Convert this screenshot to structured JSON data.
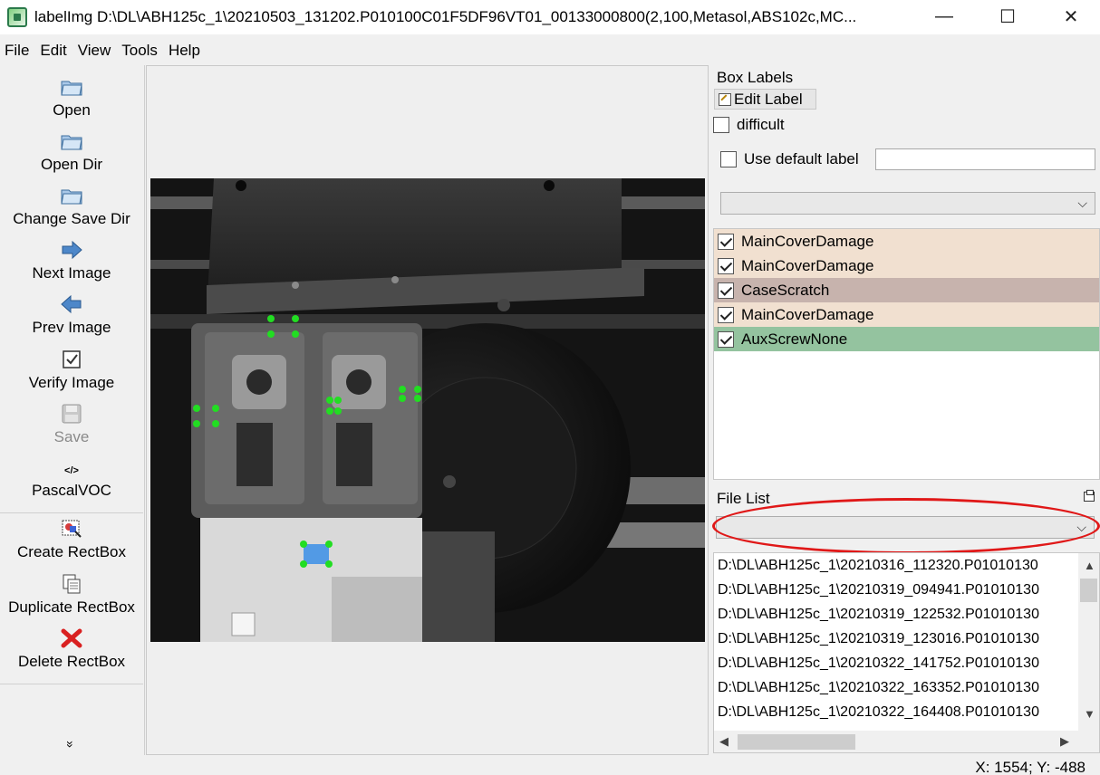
{
  "window": {
    "title": "labelImg D:\\DL\\ABH125c_1\\20210503_131202.P010100C01F5DF96VT01_00133000800(2,100,Metasol,ABS102c,MC...",
    "minimize": "—",
    "maximize": "☐",
    "close": "✕"
  },
  "menu": [
    "File",
    "Edit",
    "View",
    "Tools",
    "Help"
  ],
  "toolbar": {
    "open": "Open",
    "open_dir": "Open Dir",
    "change_save_dir": "Change Save Dir",
    "next_image": "Next Image",
    "prev_image": "Prev Image",
    "verify_image": "Verify Image",
    "save": "Save",
    "format": "PascalVOC",
    "format_icon": "</>",
    "create_rectbox": "Create RectBox",
    "duplicate_rectbox": "Duplicate RectBox",
    "delete_rectbox": "Delete RectBox",
    "more": "»"
  },
  "box_labels": {
    "title": "Box Labels",
    "edit_label": "Edit Label",
    "difficult": "difficult",
    "use_default_label": "Use default label",
    "default_label_value": "",
    "labels": [
      {
        "name": "MainCoverDamage",
        "checked": true,
        "color": "#f1e0d0"
      },
      {
        "name": "MainCoverDamage",
        "checked": true,
        "color": "#f1e0d0"
      },
      {
        "name": "CaseScratch",
        "checked": true,
        "color": "#c7b3ad"
      },
      {
        "name": "MainCoverDamage",
        "checked": true,
        "color": "#f1e0d0"
      },
      {
        "name": "AuxScrewNone",
        "checked": true,
        "color": "#94c39f"
      }
    ]
  },
  "file_list": {
    "title": "File List",
    "files": [
      "D:\\DL\\ABH125c_1\\20210316_112320.P01010130",
      "D:\\DL\\ABH125c_1\\20210319_094941.P01010130",
      "D:\\DL\\ABH125c_1\\20210319_122532.P01010130",
      "D:\\DL\\ABH125c_1\\20210319_123016.P01010130",
      "D:\\DL\\ABH125c_1\\20210322_141752.P01010130",
      "D:\\DL\\ABH125c_1\\20210322_163352.P01010130",
      "D:\\DL\\ABH125c_1\\20210322_164408.P01010130"
    ]
  },
  "status": {
    "coords": "X: 1554; Y: -488"
  },
  "colors": {
    "annotation_outline": "#e01818",
    "handle": "#22dd22",
    "selected_box": "#3a8ee6"
  }
}
